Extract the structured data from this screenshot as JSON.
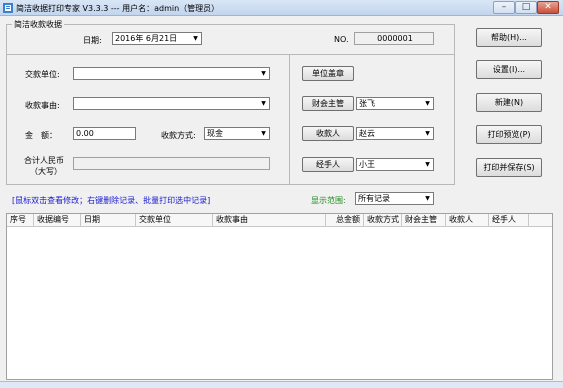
{
  "window": {
    "title": "简洁收据打印专家 V3.3.3 --- 用户名：admin（管理员）",
    "minimize": "–",
    "maximize": "□",
    "close": "✕"
  },
  "group_title": "简洁收款收据",
  "date": {
    "label": "日期:",
    "value": "2016年 6月21日"
  },
  "number": {
    "label": "NO.",
    "value": "0000001"
  },
  "form": {
    "payer_label": "交款单位:",
    "payer_value": "",
    "reason_label": "收款事由:",
    "reason_value": "",
    "amount_label": "金　额：",
    "amount_value": "0.00",
    "method_label": "收款方式:",
    "method_value": "现金",
    "rmb_label_line1": "合计人民币",
    "rmb_label_line2": "（大写）",
    "rmb_value": ""
  },
  "signers": {
    "stamp_button": "单位盖章",
    "accountant_button": "财会主管",
    "accountant_value": "张飞",
    "receiver_button": "收款人",
    "receiver_value": "赵云",
    "handler_button": "经手人",
    "handler_value": "小王"
  },
  "actions": {
    "help": "帮助(H)...",
    "settings": "设置(I)...",
    "new": "新建(N)",
    "print_preview": "打印预览(P)",
    "print_save": "打印并保存(S)"
  },
  "hint": "[鼠标双击查看修改；右键删除记录、批量打印选中记录]",
  "filter": {
    "label": "显示范围:",
    "value": "所有记录"
  },
  "table": {
    "columns": [
      "序号",
      "收据编号",
      "日期",
      "交款单位",
      "收款事由",
      "总金额",
      "收款方式",
      "财会主管",
      "收款人",
      "经手人"
    ]
  },
  "colors": {
    "hint": "#1a1acd",
    "filter_label": "#1a8a1a"
  }
}
